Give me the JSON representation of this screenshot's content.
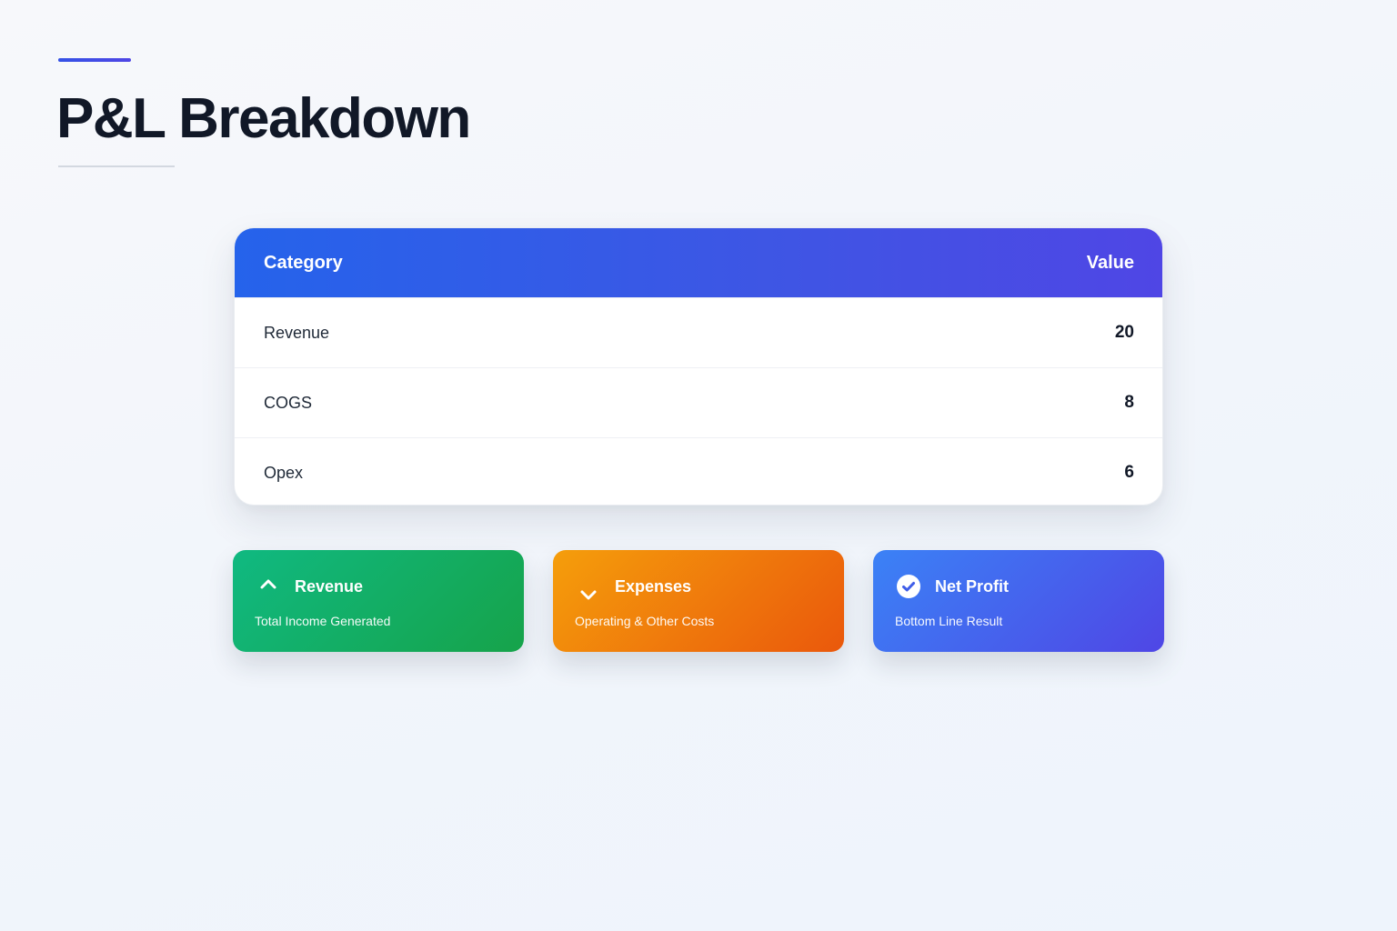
{
  "page": {
    "title": "P&L Breakdown"
  },
  "table": {
    "columns": [
      "Category",
      "Value"
    ],
    "rows": [
      {
        "category": "Revenue",
        "value": "20"
      },
      {
        "category": "COGS",
        "value": "8"
      },
      {
        "category": "Opex",
        "value": "6"
      }
    ]
  },
  "cards": [
    {
      "title": "Revenue",
      "subtitle": "Total Income Generated",
      "icon": "chevron-up-icon",
      "gradient": [
        "#10b981",
        "#16a34a"
      ]
    },
    {
      "title": "Expenses",
      "subtitle": "Operating & Other Costs",
      "icon": "chevron-down-icon",
      "gradient": [
        "#f59e0b",
        "#ea580c"
      ]
    },
    {
      "title": "Net Profit",
      "subtitle": "Bottom Line Result",
      "icon": "check-circle-icon",
      "gradient": [
        "#3b82f6",
        "#4f46e5"
      ]
    }
  ],
  "colors": {
    "accent": "#4f46e5",
    "header_gradient": [
      "#2563eb",
      "#4f46e5"
    ],
    "title_text": "#111827"
  }
}
